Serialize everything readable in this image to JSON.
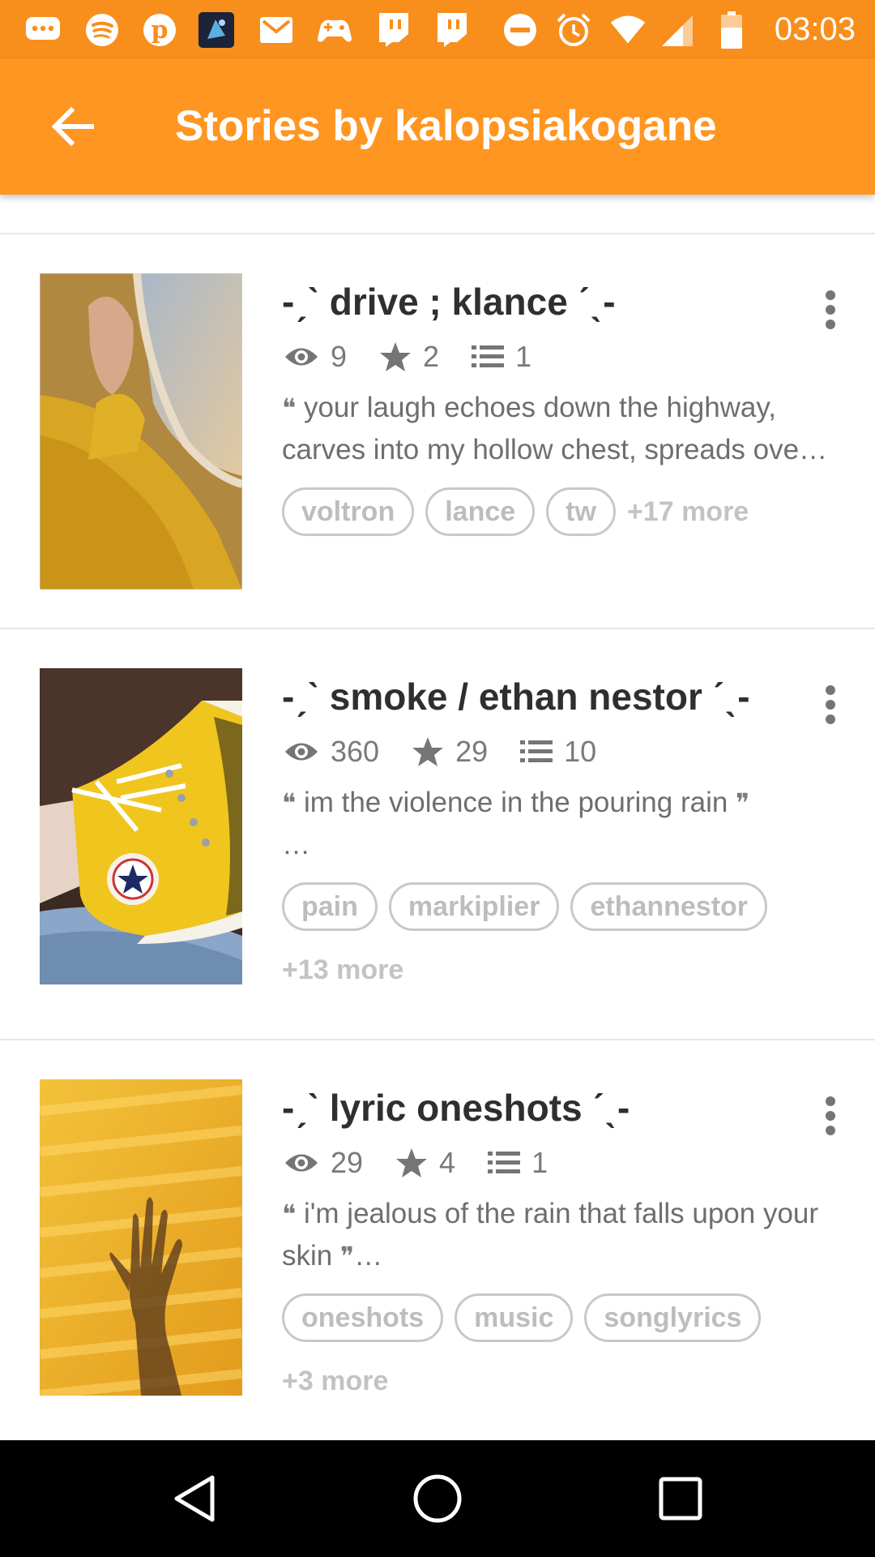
{
  "status_bar": {
    "time": "03:03",
    "icons": [
      "chat-icon",
      "spotify-icon",
      "pinterest-icon",
      "app-thumbnail-icon",
      "gmail-icon",
      "game-controller-icon",
      "twitch-icon",
      "twitch-icon",
      "do-not-disturb-icon",
      "alarm-icon",
      "wifi-icon",
      "signal-icon",
      "battery-icon"
    ]
  },
  "app_bar": {
    "back_icon": "back-arrow-icon",
    "title": "Stories by kalopsiakogane",
    "background": "#ff9621"
  },
  "stories": [
    {
      "title": "-ˏˋ drive ; klance ˊˎ-",
      "views": "9",
      "votes": "2",
      "parts": "1",
      "description": "your laugh echoes down the highway, carves into my hollow chest, spreads ove…",
      "tags": [
        "voltron",
        "lance",
        "tw"
      ],
      "more": "+17 more",
      "cover": "yellow sleeve by airplane window"
    },
    {
      "title": "-ˏˋ smoke / ethan nestor ˊˎ-",
      "views": "360",
      "votes": "29",
      "parts": "10",
      "description": "im the violence in the pouring rain",
      "description_tail": "…",
      "tags": [
        "pain",
        "markiplier",
        "ethannestor"
      ],
      "more": "+13 more",
      "cover": "yellow converse sneaker"
    },
    {
      "title": "-ˏˋ lyric oneshots ˊˎ-",
      "views": "29",
      "votes": "4",
      "parts": "1",
      "description": "i'm jealous of the rain that falls upon your skin",
      "description_tail": "…",
      "tags": [
        "oneshots",
        "music",
        "songlyrics"
      ],
      "more": "+3 more",
      "cover": "hand shadow on yellow striped wall"
    }
  ],
  "nav_bar": {
    "back": "nav-back-icon",
    "home": "nav-home-icon",
    "recents": "nav-recents-icon"
  }
}
